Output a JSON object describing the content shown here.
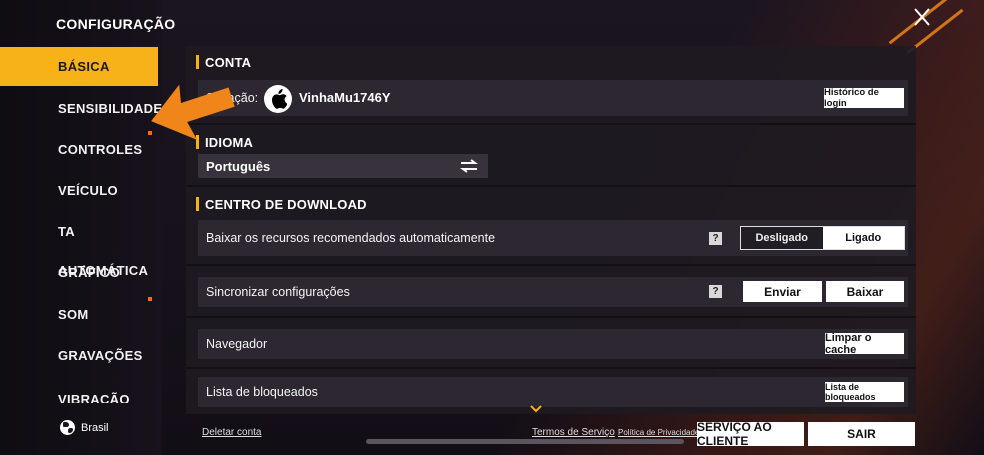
{
  "sidebar": {
    "title": "CONFIGURAÇÃO",
    "items": [
      {
        "label": "BÁSICA",
        "active": true
      },
      {
        "label": "SENSIBILIDADE"
      },
      {
        "label": "CONTROLES"
      },
      {
        "label": "VEÍCULO"
      },
      {
        "label": "TA AUTOMÁTICA"
      },
      {
        "label": "GRÁFICO"
      },
      {
        "label": "SOM"
      },
      {
        "label": "GRAVAÇÕES"
      },
      {
        "label": "VIBRAÇÃO"
      }
    ],
    "region": "Brasil"
  },
  "conta": {
    "heading": "CONTA",
    "status_label": "Situação:",
    "username": "VinhaMu1746Y",
    "login_history_button": "Histórico de login"
  },
  "idioma": {
    "heading": "IDIOMA",
    "selected": "Português"
  },
  "download": {
    "heading": "CENTRO DE DOWNLOAD",
    "auto_download_label": "Baixar os recursos recomendados automaticamente",
    "help": "?",
    "toggle_off": "Desligado",
    "toggle_on": "Ligado",
    "sync_label": "Sincronizar configurações",
    "send_button": "Enviar",
    "download_button": "Baixar",
    "browser_label": "Navegador",
    "clear_cache_button": "Limpar o cache",
    "blocklist_label": "Lista de bloqueados",
    "blocklist_button": "Lista de bloqueados"
  },
  "footer": {
    "delete_account": "Deletar conta",
    "terms": "Termos de Serviço",
    "privacy": "Política de Privacidade",
    "customer_service": "SERVIÇO AO CLIENTE",
    "exit": "SAIR"
  },
  "colors": {
    "accent": "#f7b21a",
    "arrow": "#f0851a"
  }
}
